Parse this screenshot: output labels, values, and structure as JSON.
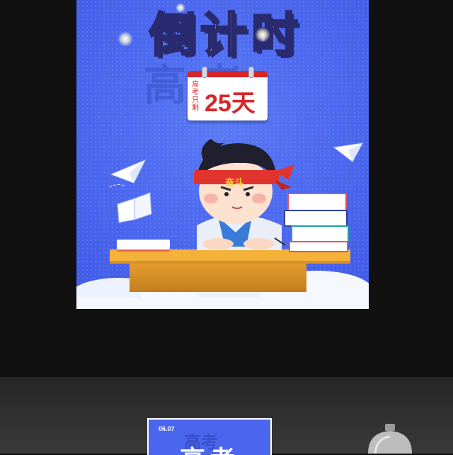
{
  "poster": {
    "title": "倒计时",
    "watermark": "高考",
    "calendar": {
      "side_text": "高考只剩",
      "days": "25天"
    },
    "headband_text": "奋斗"
  },
  "mockup": {
    "date": "06.07",
    "big_text": "高考",
    "watermark": "高考"
  },
  "colors": {
    "poster_blue": "#4d6af0",
    "title_yellow": "#ffd428",
    "calendar_red": "#d9252a",
    "desk_orange": "#f4b23b"
  }
}
